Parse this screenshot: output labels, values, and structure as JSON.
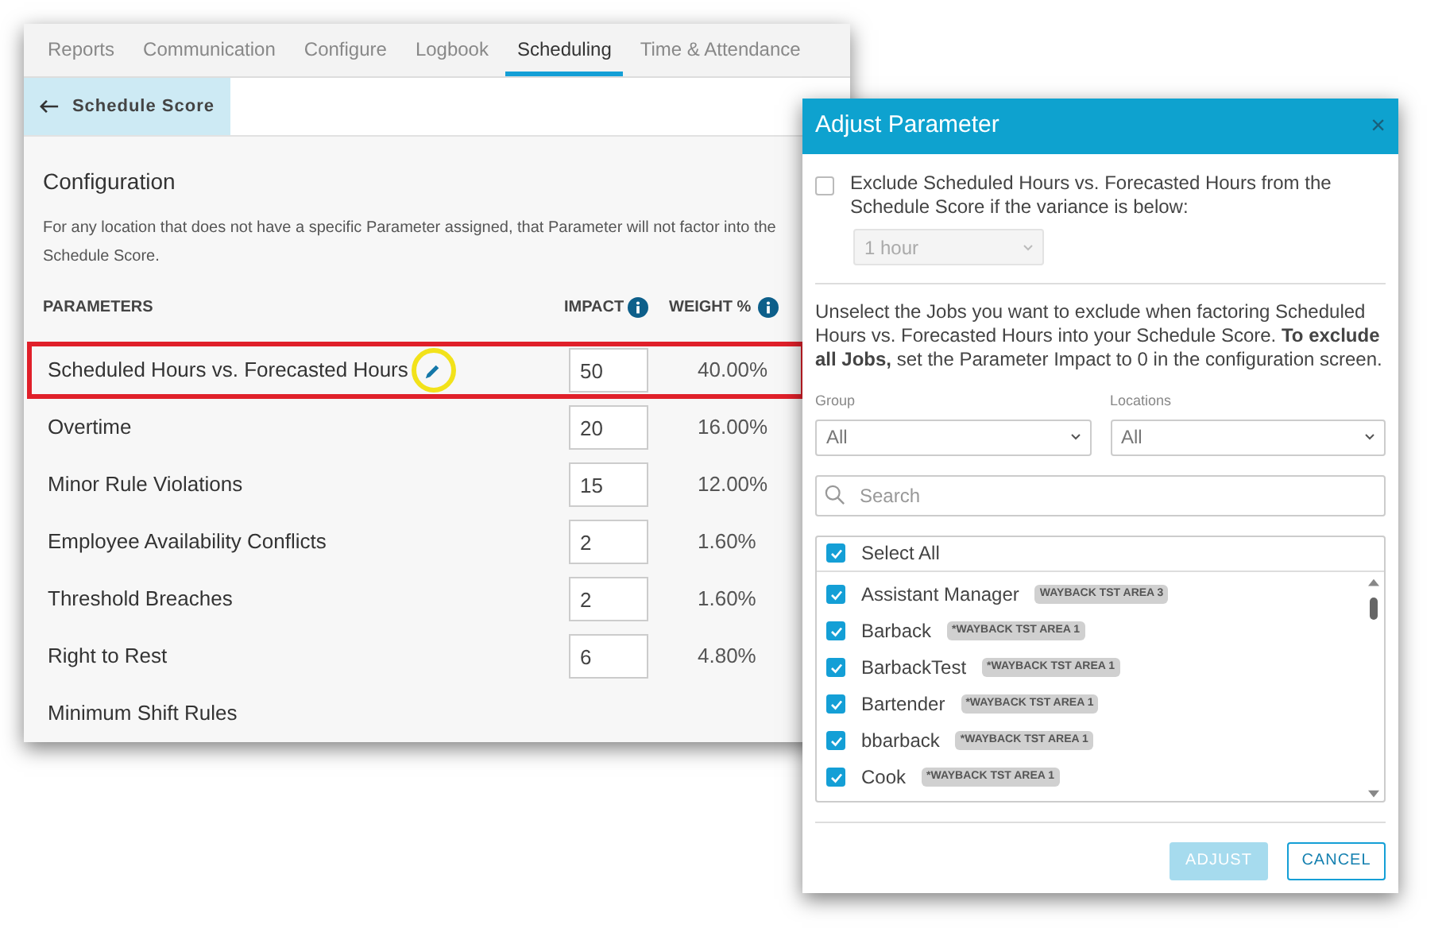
{
  "tabs": [
    {
      "label": "Reports",
      "selected": false
    },
    {
      "label": "Communication",
      "selected": false
    },
    {
      "label": "Configure",
      "selected": false
    },
    {
      "label": "Logbook",
      "selected": false
    },
    {
      "label": "Scheduling",
      "selected": true
    },
    {
      "label": "Time & Attendance",
      "selected": false
    }
  ],
  "back_link": {
    "label": "Schedule Score"
  },
  "configuration": {
    "title": "Configuration",
    "description": "For any location that does not have a specific Parameter assigned, that Parameter will not factor into the Schedule Score.",
    "columns": {
      "parameters": "PARAMETERS",
      "impact": "IMPACT",
      "weight": "WEIGHT %"
    },
    "rows": [
      {
        "name": "Scheduled Hours vs. Forecasted Hours",
        "impact": "50",
        "weight": "40.00%",
        "highlighted": true,
        "editable": true
      },
      {
        "name": "Overtime",
        "impact": "20",
        "weight": "16.00%",
        "highlighted": false,
        "editable": false
      },
      {
        "name": "Minor Rule Violations",
        "impact": "15",
        "weight": "12.00%",
        "highlighted": false,
        "editable": false
      },
      {
        "name": "Employee Availability Conflicts",
        "impact": "2",
        "weight": "1.60%",
        "highlighted": false,
        "editable": false
      },
      {
        "name": "Threshold Breaches",
        "impact": "2",
        "weight": "1.60%",
        "highlighted": false,
        "editable": false
      },
      {
        "name": "Right to Rest",
        "impact": "6",
        "weight": "4.80%",
        "highlighted": false,
        "editable": false
      },
      {
        "name": "Minimum Shift Rules",
        "highlighted": false,
        "editable": false
      }
    ]
  },
  "dialog": {
    "title": "Adjust Parameter",
    "close": "×",
    "exclude_option": {
      "checked": false,
      "text": "Exclude Scheduled Hours vs. Forecasted Hours from the Schedule Score if the variance is below:",
      "variance": {
        "value": "1 hour",
        "disabled": true
      }
    },
    "instructions": "Unselect the Jobs you want to exclude when factoring Scheduled Hours vs. Forecasted Hours into your Schedule Score. **To exclude all Jobs,** set the Parameter Impact to 0 in the configuration screen.",
    "filters": [
      {
        "label": "Group",
        "value": "All"
      },
      {
        "label": "Locations",
        "value": "All"
      }
    ],
    "search": {
      "placeholder": "Search"
    },
    "select_all": {
      "label": "Select All",
      "checked": true
    },
    "jobs": [
      {
        "name": "Assistant Manager",
        "area": "WAYBACK TST AREA 3",
        "checked": true
      },
      {
        "name": "Barback",
        "area": "*WAYBACK TST AREA 1",
        "checked": true
      },
      {
        "name": "BarbackTest",
        "area": "*WAYBACK TST AREA 1",
        "checked": true
      },
      {
        "name": "Bartender",
        "area": "*WAYBACK TST AREA 1",
        "checked": true
      },
      {
        "name": "bbarback",
        "area": "*WAYBACK TST AREA 1",
        "checked": true
      },
      {
        "name": "Cook",
        "area": "*WAYBACK TST AREA 1",
        "checked": true
      }
    ],
    "buttons": [
      {
        "label": "ADJUST",
        "kind": "primary",
        "disabled": true
      },
      {
        "label": "CANCEL",
        "kind": "secondary",
        "disabled": false
      }
    ]
  }
}
